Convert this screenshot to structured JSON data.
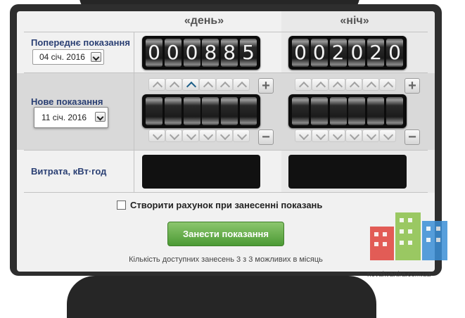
{
  "columns": {
    "day": "«день»",
    "night": "«ніч»"
  },
  "previous": {
    "label": "Попереднє показання",
    "date": "04 січ. 2016",
    "day_digits": [
      "0",
      "0",
      "0",
      "8",
      "8",
      "5"
    ],
    "night_digits": [
      "0",
      "0",
      "2",
      "0",
      "2",
      "0"
    ]
  },
  "new_reading": {
    "label": "Нове показання",
    "date": "11 січ. 2016",
    "day_digits": [
      "",
      "",
      "",
      "",
      "",
      ""
    ],
    "night_digits": [
      "",
      "",
      "",
      "",
      "",
      ""
    ],
    "plus": "+",
    "minus": "−"
  },
  "usage": {
    "label": "Витрата, кВт·год",
    "day_value": "",
    "night_value": ""
  },
  "invoice_checkbox": {
    "label": "Створити рахунок при занесенні показань",
    "checked": false
  },
  "submit_button": {
    "label": "Занести показання"
  },
  "note": "Кількість доступних занесень 3 з 3 можливих в місяць",
  "watermark": {
    "text": "novakvartira.com.ua",
    "colors": [
      "#e0433b",
      "#8cc24a",
      "#3a8fd6"
    ]
  }
}
